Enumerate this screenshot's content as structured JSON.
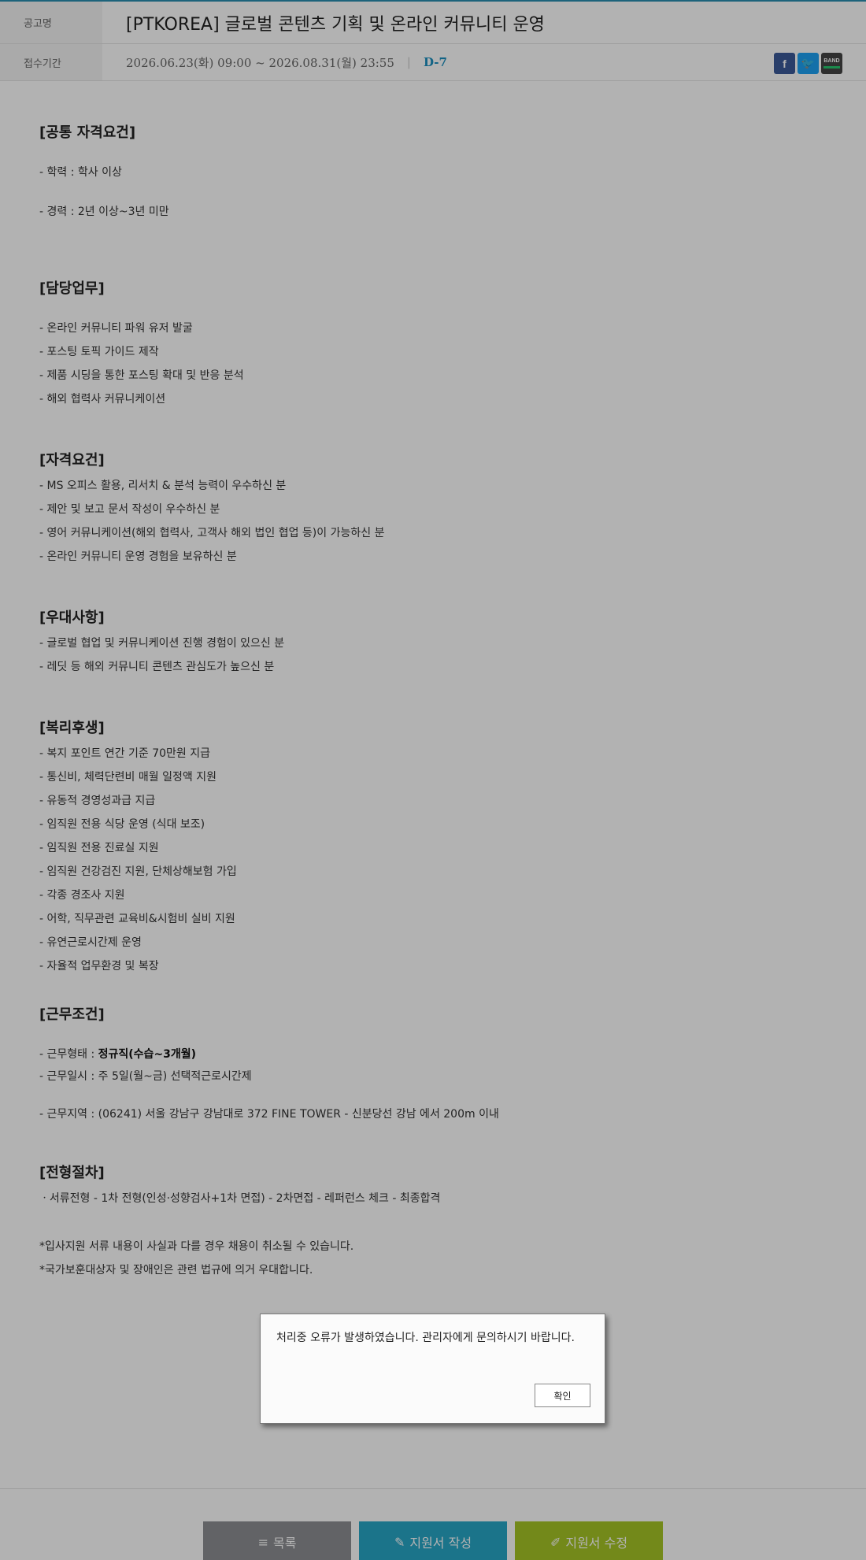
{
  "header": {
    "title_label": "공고명",
    "title": "[PTKOREA] 글로벌 콘텐츠 기획 및 온라인 커뮤니티 운영",
    "period_label": "접수기간",
    "period": "2026.06.23(화) 09:00 ~ 2026.08.31(월) 23:55",
    "separator": "|",
    "dday": "D-7",
    "sns": {
      "facebook": "f",
      "twitter": "🐦",
      "band": "BAND"
    }
  },
  "sections": {
    "common": {
      "title": "[공통 자격요건]",
      "items": [
        "- 학력 : 학사 이상",
        "- 경력 : 2년 이상~3년 미만"
      ]
    },
    "duties": {
      "title": "[담당업무]",
      "items": [
        "- 온라인 커뮤니티 파워 유저 발굴",
        "- 포스팅 토픽 가이드 제작",
        "- 제품 시딩을 통한 포스팅 확대 및 반응 분석",
        "- 해외 협력사 커뮤니케이션"
      ]
    },
    "qual": {
      "title": "[자격요건]",
      "items": [
        "- MS 오피스 활용, 리서치 & 분석 능력이 우수하신 분",
        "- 제안 및 보고 문서 작성이 우수하신 분",
        "- 영어 커뮤니케이션(해외 협력사, 고객사 해외 법인 협업 등)이 가능하신 분",
        "- 온라인 커뮤니티 운영 경험을 보유하신 분"
      ]
    },
    "pref": {
      "title": "[우대사항]",
      "items": [
        "- 글로벌 협업 및 커뮤니케이션 진행 경험이 있으신 분",
        "- 레딧 등 해외 커뮤니티 콘텐츠 관심도가 높으신 분"
      ]
    },
    "welfare": {
      "title": "[복리후생]",
      "items": [
        "- 복지 포인트 연간 기준 70만원 지급",
        "- 통신비, 체력단련비 매월 일정액 지원",
        "- 유동적 경영성과급 지급",
        "- 임직원 전용 식당 운영 (식대 보조)",
        "- 임직원 전용 진료실 지원",
        "- 임직원 건강검진 지원, 단체상해보험 가입",
        "- 각종 경조사 지원",
        "- 어학, 직무관련 교육비&시험비 실비 지원",
        "- 유연근로시간제 운영",
        "- 자율적 업무환경 및 복장"
      ]
    },
    "work": {
      "title": "[근무조건]",
      "type_prefix": "- 근무형태 : ",
      "type_value": "정규직(수습~3개월)",
      "hours": "- 근무일시 : 주 5일(월~금) 선택적근로시간제",
      "location": "- 근무지역 : (06241) 서울 강남구 강남대로 372 FINE TOWER - 신분당선 강남 에서 200m 이내"
    },
    "process": {
      "title": "[전형절차]",
      "items": [
        "ㆍ서류전형 - 1차 전형(인성·성향검사+1차 면접) - 2차면접 - 레퍼런스 체크 - 최종합격"
      ]
    },
    "notes": [
      "*입사지원 서류 내용이 사실과 다를 경우 채용이 취소될 수 있습니다.",
      "*국가보훈대상자 및 장애인은 관련 법규에 의거 우대합니다."
    ]
  },
  "modal": {
    "message": "처리중 오류가 발생하였습니다. 관리자에게 문의하시기 바랍니다.",
    "confirm": "확인"
  },
  "footer": {
    "list_icon": "≡",
    "list": "목록",
    "write_icon": "✎",
    "write": "지원서 작성",
    "edit_icon": "✐",
    "edit": "지원서 수정"
  },
  "colors": {
    "accent": "#2a8fb0",
    "dday": "#1b8fbf",
    "list_btn": "#8d8f92",
    "write_btn": "#27a6c6",
    "edit_btn": "#a5c426"
  }
}
